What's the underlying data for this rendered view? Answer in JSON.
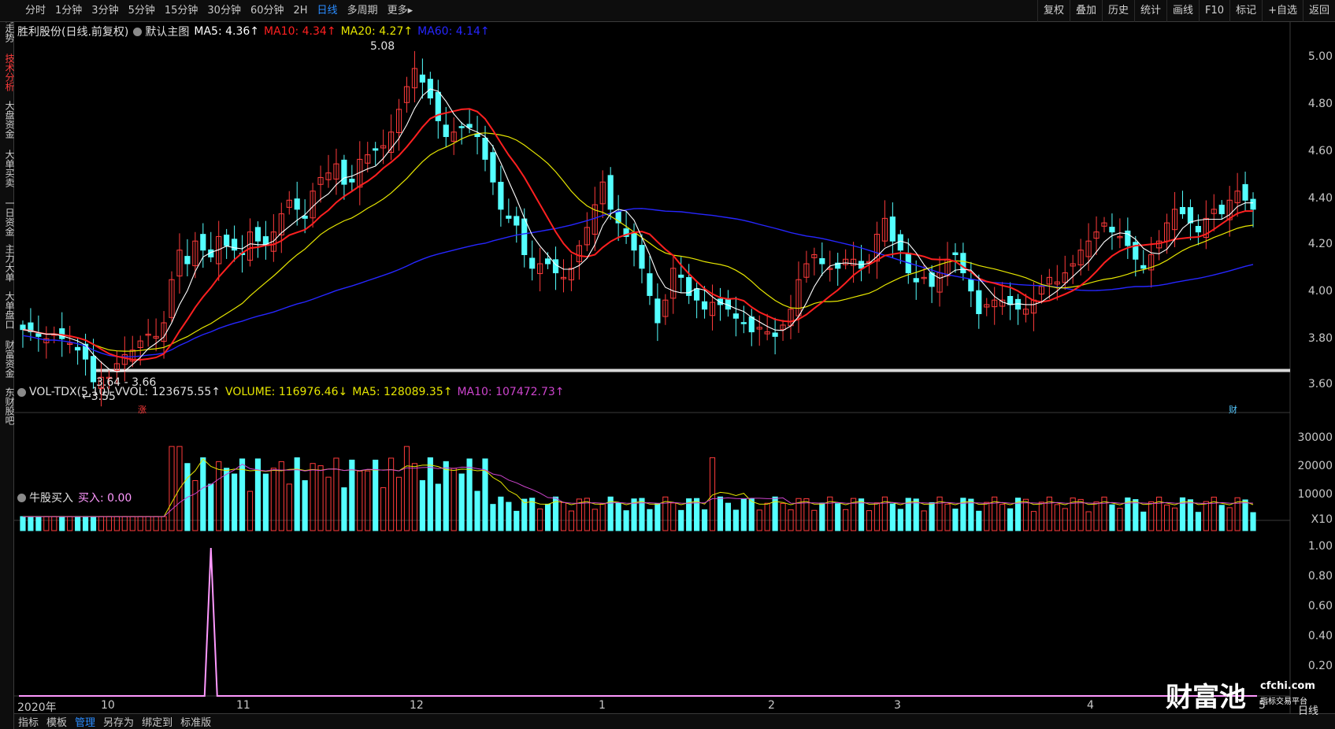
{
  "top_tabs": [
    "分时",
    "1分钟",
    "3分钟",
    "5分钟",
    "15分钟",
    "30分钟",
    "60分钟",
    "2H",
    "日线",
    "多周期",
    "更多▸"
  ],
  "active_tab": "日线",
  "tools": [
    "复权",
    "叠加",
    "历史",
    "统计",
    "画线",
    "F10",
    "标记",
    "+自选",
    "返回"
  ],
  "sidebar": [
    "分时走势",
    "技术分析",
    "大盘资金",
    "大单买卖",
    "一日资金",
    "主力大单",
    "大单盘口",
    "财富资金",
    "东财股吧"
  ],
  "sidebar_active": "技术分析",
  "main_legend": {
    "title": "胜利股份(日线.前复权)",
    "template": "默认主图",
    "ma5": "MA5: 4.36↑",
    "ma10": "MA10: 4.34↑",
    "ma20": "MA20: 4.27↑",
    "ma60": "MA60: 4.14↑"
  },
  "vol_legend": {
    "name": "VOL-TDX(5,10)",
    "vvol": "VVOL: 123675.55↑",
    "volume": "VOLUME: 116976.46↓",
    "ma5": "MA5: 128089.35↑",
    "ma10": "MA10: 107472.73↑"
  },
  "ind_legend": {
    "name": "牛股买入",
    "buy": "买入: 0.00"
  },
  "annotations": {
    "high": "5.08",
    "low": "3.55",
    "range": "3.64 - 3.66",
    "zhang": "涨",
    "cai": "财"
  },
  "main_y_labels": [
    "5.00",
    "4.80",
    "4.60",
    "4.40",
    "4.20",
    "4.00",
    "3.80",
    "3.60"
  ],
  "vol_y_labels": [
    "30000",
    "20000",
    "10000",
    "X10"
  ],
  "ind_y_labels": [
    "1.00",
    "0.80",
    "0.60",
    "0.40",
    "0.20"
  ],
  "x_labels": [
    "2020年",
    "10",
    "11",
    "12",
    "1",
    "2",
    "3",
    "4",
    "5"
  ],
  "bottom_tabs": [
    "指标",
    "模板",
    "管理",
    "另存为",
    "绑定到",
    "标准版"
  ],
  "bottom_active": "管理",
  "watermark": "财富池",
  "watermark_site": "cfchi.com",
  "watermark_sub": "指标交易平台",
  "right_mini": "日线",
  "colors": {
    "up": "#ff3b3b",
    "down": "#54ffff",
    "ma5": "#ffffff",
    "ma10": "#ff2020",
    "ma20": "#e6e600",
    "ma60": "#2626ff",
    "vol_ma5": "#e6e600",
    "vol_ma10": "#cc44cc",
    "signal": "#ff99ff"
  },
  "chart_data": {
    "type": "candlestick",
    "price_range": [
      3.55,
      5.08
    ],
    "closes": [
      3.83,
      3.82,
      3.8,
      3.79,
      3.81,
      3.79,
      3.77,
      3.74,
      3.7,
      3.6,
      3.62,
      3.62,
      3.68,
      3.72,
      3.74,
      3.78,
      3.81,
      3.8,
      3.86,
      4.05,
      4.18,
      4.12,
      4.22,
      4.18,
      4.15,
      4.24,
      4.2,
      4.18,
      4.16,
      4.26,
      4.22,
      4.2,
      4.26,
      4.34,
      4.4,
      4.36,
      4.32,
      4.44,
      4.5,
      4.52,
      4.56,
      4.47,
      4.48,
      4.58,
      4.6,
      4.62,
      4.64,
      4.7,
      4.8,
      4.9,
      4.98,
      4.92,
      4.85,
      4.75,
      4.68,
      4.7,
      4.72,
      4.72,
      4.68,
      4.58,
      4.48,
      4.36,
      4.32,
      4.29,
      4.16,
      4.1,
      4.12,
      4.12,
      4.08,
      4.06,
      4.1,
      4.2,
      4.28,
      4.38,
      4.48,
      4.36,
      4.3,
      4.24,
      4.18,
      4.1,
      3.98,
      3.86,
      3.96,
      4.1,
      4.06,
      3.98,
      3.96,
      3.92,
      3.95,
      3.94,
      3.92,
      3.88,
      3.86,
      3.82,
      3.84,
      3.82,
      3.8,
      3.85,
      3.92,
      4.05,
      4.12,
      4.16,
      4.12,
      4.1,
      4.1,
      4.14,
      4.14,
      4.1,
      4.13,
      4.25,
      4.32,
      4.22,
      4.18,
      4.08,
      4.04,
      4.06,
      4.02,
      4.08,
      4.14,
      4.16,
      4.08,
      4.0,
      3.9,
      3.94,
      3.96,
      3.96,
      3.94,
      3.92,
      3.92,
      3.96,
      4.02,
      4.06,
      4.04,
      4.08,
      4.12,
      4.18,
      4.22,
      4.26,
      4.3,
      4.26,
      4.24,
      4.2,
      4.14,
      4.1,
      4.16,
      4.22,
      4.3,
      4.36,
      4.34,
      4.3,
      4.26,
      4.32,
      4.36,
      4.34,
      4.4,
      4.44,
      4.4,
      4.36
    ],
    "signal_index": 24,
    "reference_line": 3.65
  }
}
